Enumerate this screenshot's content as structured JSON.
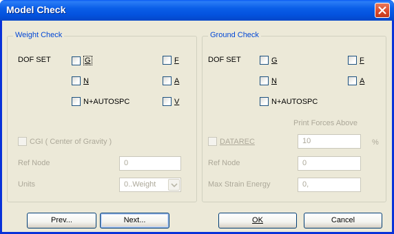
{
  "window": {
    "title": "Model Check"
  },
  "weight_check": {
    "title": "Weight Check",
    "dof_label": "DOF SET",
    "checkboxes": {
      "g": "G",
      "f": "F",
      "n": "N",
      "a": "A",
      "n_autospc": "N+AUTOSPC",
      "v": "V"
    },
    "cgi_label": "CGI ( Center of Gravity )",
    "ref_node_label": "Ref Node",
    "ref_node_value": "0",
    "units_label": "Units",
    "units_value": "0..Weight"
  },
  "ground_check": {
    "title": "Ground Check",
    "dof_label": "DOF SET",
    "checkboxes": {
      "g": "G",
      "f": "F",
      "n": "N",
      "a": "A",
      "n_autospc": "N+AUTOSPC"
    },
    "print_forces_label": "Print Forces Above",
    "datarec_label": "DATAREC",
    "datarec_value": "10",
    "percent_label": "%",
    "ref_node_label": "Ref Node",
    "ref_node_value": "0",
    "max_strain_label": "Max Strain Energy",
    "max_strain_value": "0,"
  },
  "buttons": {
    "prev": "Prev...",
    "next": "Next...",
    "ok": "OK",
    "cancel": "Cancel"
  }
}
